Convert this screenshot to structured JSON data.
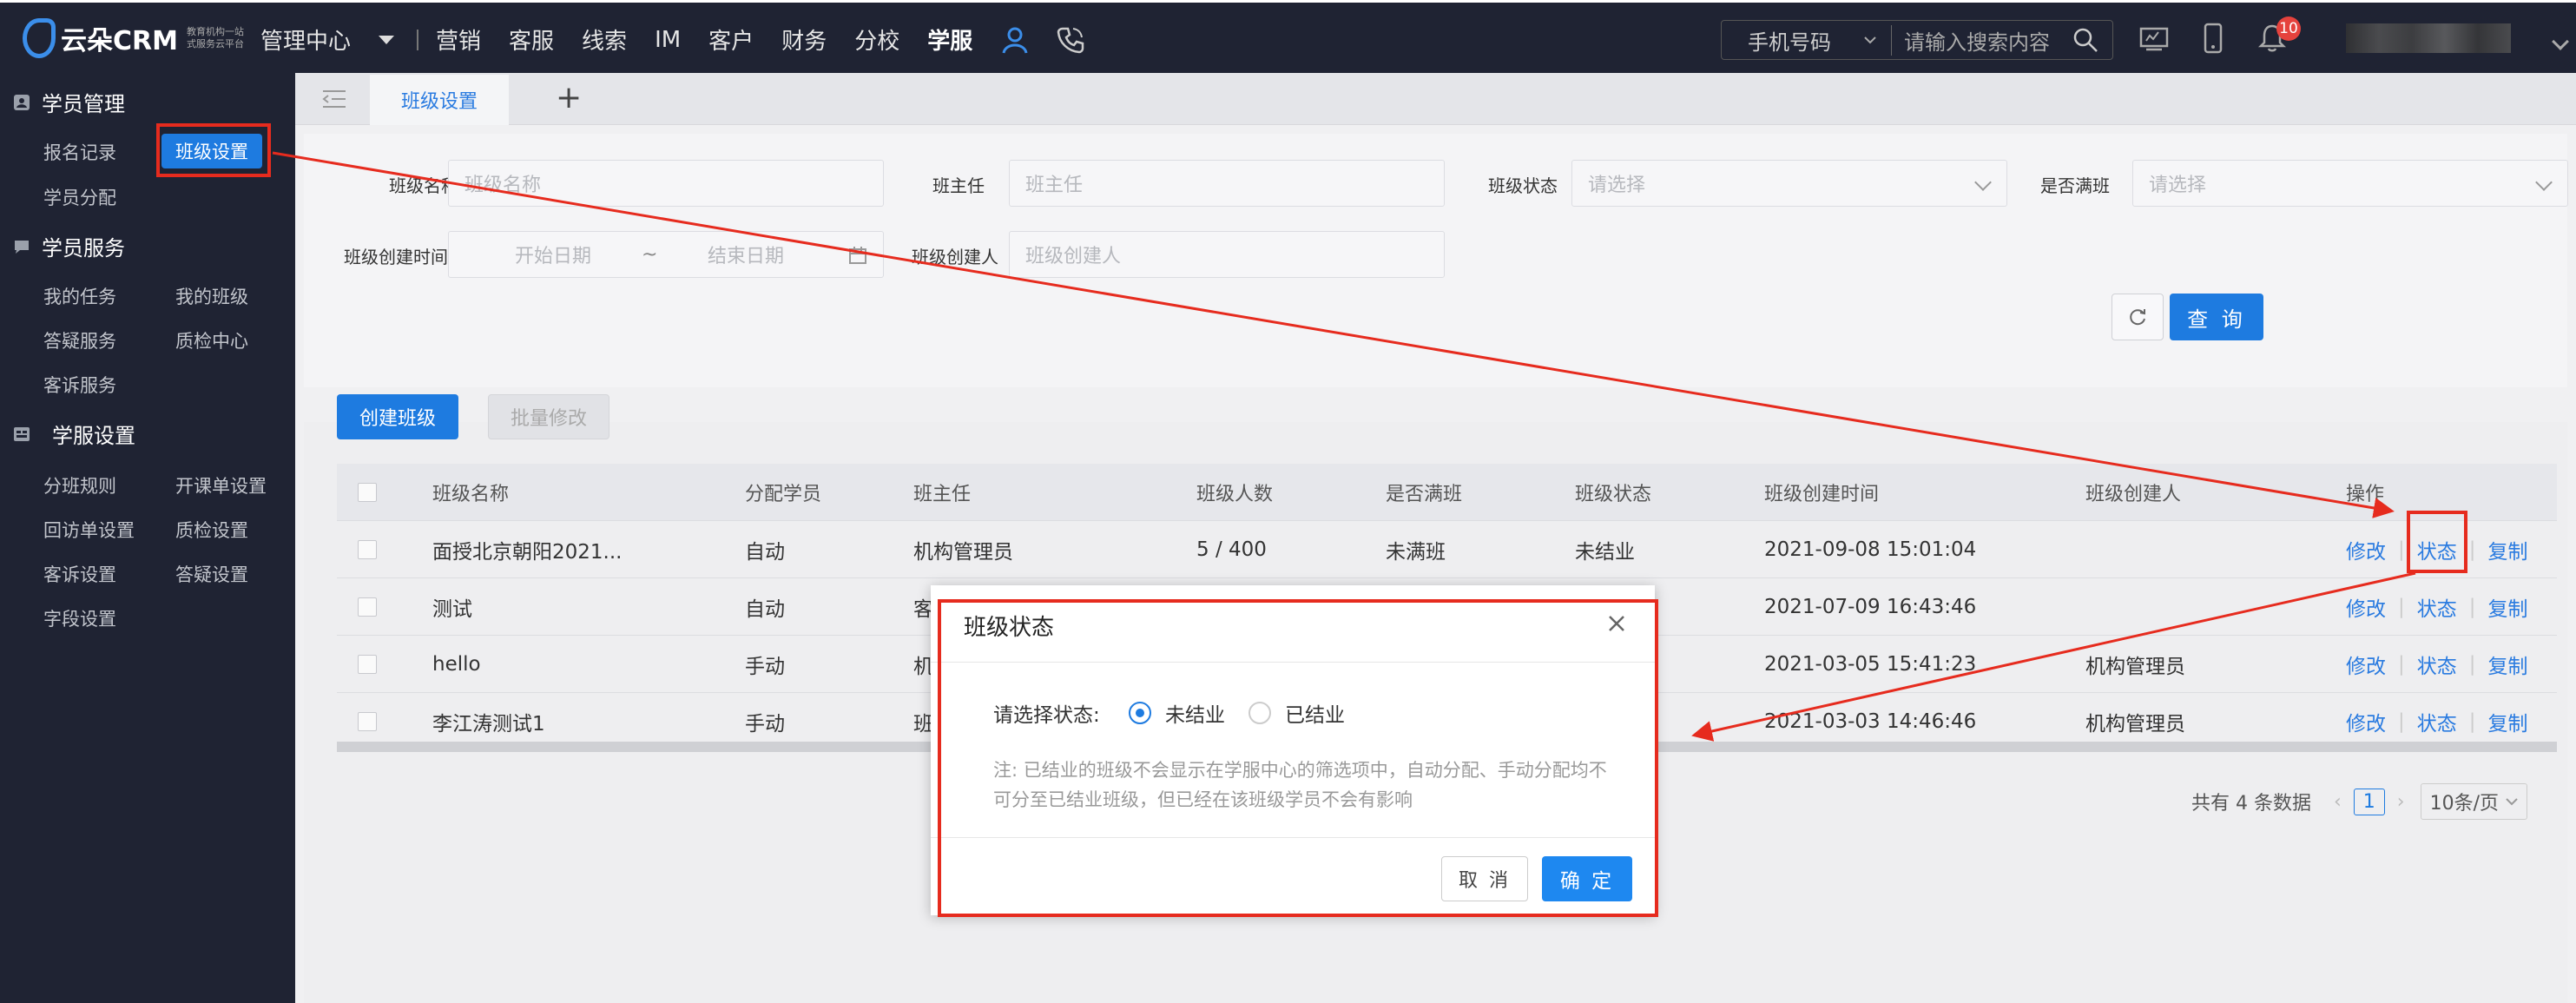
{
  "header": {
    "logo_text": "云朵CRM",
    "logo_sub_1": "教育机构一站",
    "logo_sub_2": "式服务云平台",
    "mgmt_center": "管理中心",
    "nav": [
      "营销",
      "客服",
      "线索",
      "IM",
      "客户",
      "财务",
      "分校",
      "学服"
    ],
    "active_nav": "学服",
    "search_type": "手机号码",
    "search_placeholder": "请输入搜索内容",
    "notification_count": "10"
  },
  "sidebar": {
    "groups": [
      {
        "title": "学员管理",
        "icon": "user-card-icon"
      },
      {
        "title": "学员服务",
        "icon": "chat-bubble-icon"
      },
      {
        "title": "学服设置",
        "icon": "settings-panel-icon"
      }
    ],
    "links": {
      "enroll_record": "报名记录",
      "class_settings": "班级设置",
      "student_assign": "学员分配",
      "my_tasks": "我的任务",
      "my_classes": "我的班级",
      "qa_service": "答疑服务",
      "qc_center": "质检中心",
      "complaint_service": "客诉服务",
      "assign_rules": "分班规则",
      "open_class_settings": "开课单设置",
      "revisit_settings": "回访单设置",
      "qc_settings": "质检设置",
      "complaint_settings": "客诉设置",
      "qa_settings": "答疑设置",
      "field_settings": "字段设置"
    }
  },
  "tabs": {
    "active": "班级设置",
    "add": "+"
  },
  "filters": {
    "class_name_label": "班级名称",
    "class_name_ph": "班级名称",
    "head_teacher_label": "班主任",
    "head_teacher_ph": "班主任",
    "class_status_label": "班级状态",
    "class_status_ph": "请选择",
    "is_full_label": "是否满班",
    "is_full_ph": "请选择",
    "created_time_label": "班级创建时间",
    "start_ph": "开始日期",
    "tilde": "~",
    "end_ph": "结束日期",
    "creator_label": "班级创建人",
    "creator_ph": "班级创建人",
    "query": "查 询"
  },
  "actions": {
    "create": "创建班级",
    "batch_edit": "批量修改"
  },
  "table": {
    "columns": [
      "班级名称",
      "分配学员",
      "班主任",
      "班级人数",
      "是否满班",
      "班级状态",
      "班级创建时间",
      "班级创建人",
      "操作"
    ],
    "rows": [
      {
        "name": "面授北京朝阳2021...",
        "assign": "自动",
        "teacher": "机构管理员",
        "count": "5 / 400",
        "full": "未满班",
        "status": "未结业",
        "created": "2021-09-08 15:01:04",
        "creator": ""
      },
      {
        "name": "测试",
        "assign": "自动",
        "teacher": "客",
        "count": "",
        "full": "",
        "status": "",
        "created": "2021-07-09 16:43:46",
        "creator": ""
      },
      {
        "name": "hello",
        "assign": "手动",
        "teacher": "机",
        "count": "",
        "full": "",
        "status": "",
        "created": "2021-03-05 15:41:23",
        "creator": "机构管理员"
      },
      {
        "name": "李江涛测试1",
        "assign": "手动",
        "teacher": "班",
        "count": "",
        "full": "",
        "status": "",
        "created": "2021-03-03 14:46:46",
        "creator": "机构管理员"
      }
    ],
    "ops": {
      "edit": "修改",
      "status": "状态",
      "copy": "复制"
    }
  },
  "pager": {
    "total": "共有 4 条数据",
    "page": "1",
    "page_size": "10条/页"
  },
  "modal": {
    "title": "班级状态",
    "label": "请选择状态:",
    "option_1": "未结业",
    "option_2": "已结业",
    "selected": "未结业",
    "note": "注: 已结业的班级不会显示在学服中心的筛选项中，自动分配、手动分配均不可分至已结业班级，但已经在该班级学员不会有影响",
    "cancel": "取 消",
    "ok": "确 定"
  },
  "colors": {
    "primary": "#1e7be0",
    "nav_bg": "#1f2333",
    "annotation": "#e62b1e"
  }
}
